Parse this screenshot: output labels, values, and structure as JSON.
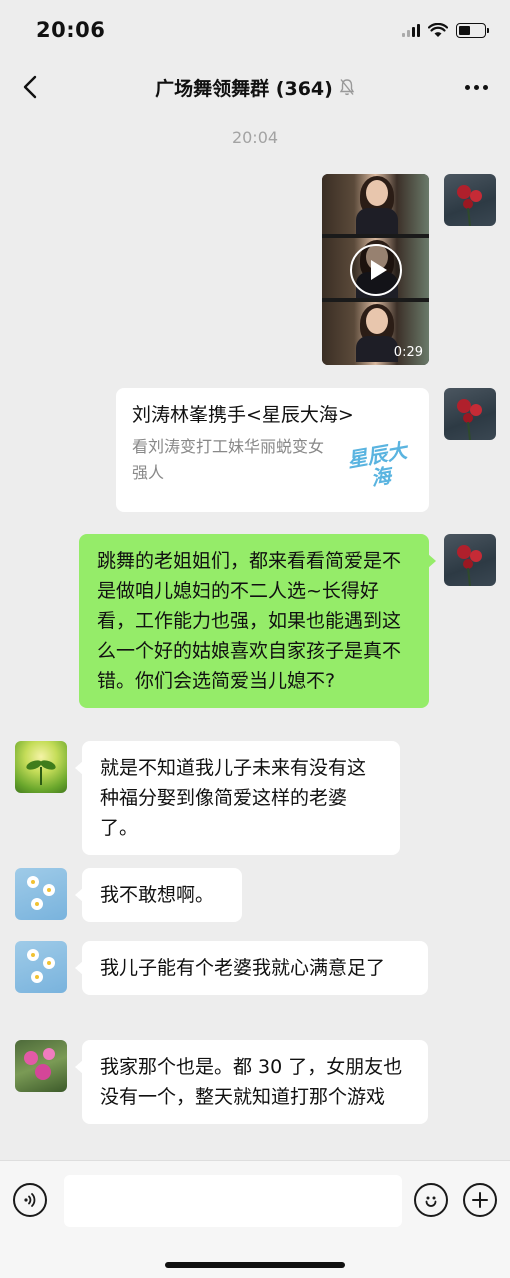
{
  "status_bar": {
    "time": "20:06"
  },
  "nav": {
    "title": "广场舞领舞群 (364)"
  },
  "timestamp": "20:04",
  "video": {
    "duration": "0:29"
  },
  "link_card": {
    "title": "刘涛林峯携手<星辰大海>",
    "description": "看刘涛变打工妹华丽蜕变女强人",
    "logo_text": "星辰大海"
  },
  "messages": [
    {
      "side": "right",
      "text": "跳舞的老姐姐们，都来看看简爱是不是做咱儿媳妇的不二人选~长得好看，工作能力也强，如果也能遇到这么一个好的姑娘喜欢自家孩子是真不错。你们会选简爱当儿媳不?"
    },
    {
      "side": "left",
      "text": "就是不知道我儿子未来有没有这种福分娶到像简爱这样的老婆了。"
    },
    {
      "side": "left",
      "text": "我不敢想啊。"
    },
    {
      "side": "left",
      "text": "我儿子能有个老婆我就心满意足了"
    },
    {
      "side": "left",
      "text": "我家那个也是。都 30 了，女朋友也没有一个，整天就知道打那个游戏"
    }
  ],
  "input": {
    "placeholder": ""
  },
  "colors": {
    "background": "#ededed",
    "bubble_green": "#95ec69",
    "bubble_white": "#ffffff"
  },
  "icons": [
    "back-icon",
    "mute-icon",
    "more-icon",
    "play-icon",
    "voice-icon",
    "emoji-icon",
    "plus-icon"
  ]
}
